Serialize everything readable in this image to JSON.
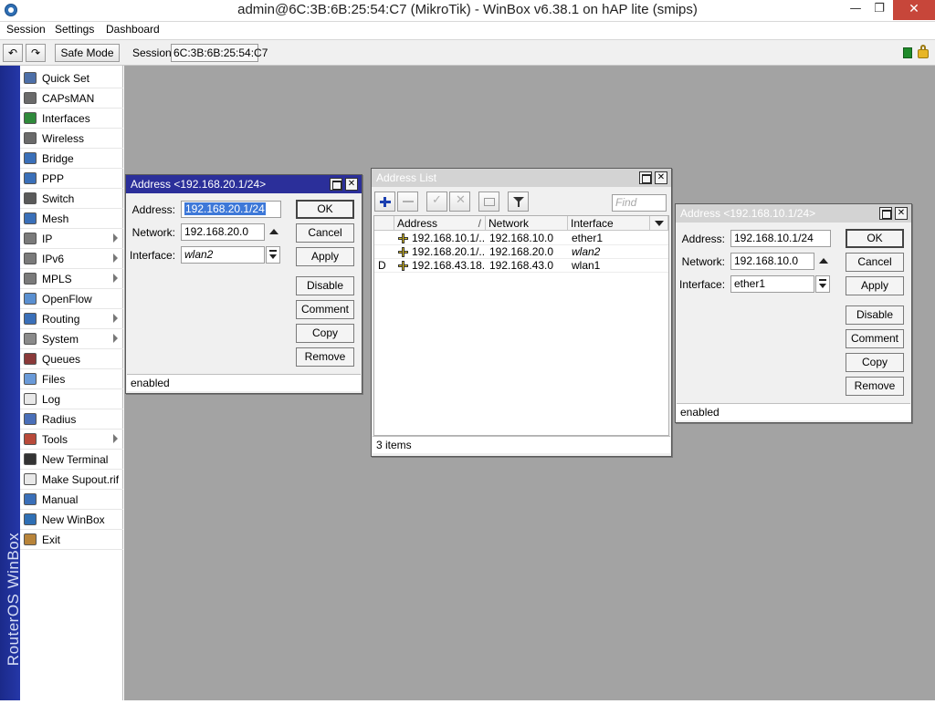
{
  "window": {
    "title": "admin@6C:3B:6B:25:54:C7 (MikroTik) - WinBox v6.38.1 on hAP lite (smips)",
    "min_glyph": "—",
    "max_glyph": "❐",
    "close_glyph": "✕"
  },
  "menu": [
    "Session",
    "Settings",
    "Dashboard"
  ],
  "toolbar": {
    "undo_glyph": "↶",
    "redo_glyph": "↷",
    "safe_mode": "Safe Mode",
    "session_label": "Session:",
    "session_value": "6C:3B:6B:25:54:C7"
  },
  "sidebar": {
    "brand": "RouterOS WinBox",
    "items": [
      {
        "label": "Quick Set",
        "icon": "quick-set-icon",
        "submenu": false
      },
      {
        "label": "CAPsMAN",
        "icon": "capsman-icon",
        "submenu": false
      },
      {
        "label": "Interfaces",
        "icon": "interfaces-icon",
        "submenu": false
      },
      {
        "label": "Wireless",
        "icon": "wireless-icon",
        "submenu": false
      },
      {
        "label": "Bridge",
        "icon": "bridge-icon",
        "submenu": false
      },
      {
        "label": "PPP",
        "icon": "ppp-icon",
        "submenu": false
      },
      {
        "label": "Switch",
        "icon": "switch-icon",
        "submenu": false
      },
      {
        "label": "Mesh",
        "icon": "mesh-icon",
        "submenu": false
      },
      {
        "label": "IP",
        "icon": "ip-icon",
        "submenu": true
      },
      {
        "label": "IPv6",
        "icon": "ipv6-icon",
        "submenu": true
      },
      {
        "label": "MPLS",
        "icon": "mpls-icon",
        "submenu": true
      },
      {
        "label": "OpenFlow",
        "icon": "openflow-icon",
        "submenu": false
      },
      {
        "label": "Routing",
        "icon": "routing-icon",
        "submenu": true
      },
      {
        "label": "System",
        "icon": "system-icon",
        "submenu": true
      },
      {
        "label": "Queues",
        "icon": "queues-icon",
        "submenu": false
      },
      {
        "label": "Files",
        "icon": "files-icon",
        "submenu": false
      },
      {
        "label": "Log",
        "icon": "log-icon",
        "submenu": false
      },
      {
        "label": "Radius",
        "icon": "radius-icon",
        "submenu": false
      },
      {
        "label": "Tools",
        "icon": "tools-icon",
        "submenu": true
      },
      {
        "label": "New Terminal",
        "icon": "terminal-icon",
        "submenu": false
      },
      {
        "label": "Make Supout.rif",
        "icon": "supout-icon",
        "submenu": false
      },
      {
        "label": "Manual",
        "icon": "manual-icon",
        "submenu": false
      },
      {
        "label": "New WinBox",
        "icon": "winbox-icon",
        "submenu": false
      },
      {
        "label": "Exit",
        "icon": "exit-icon",
        "submenu": false
      }
    ]
  },
  "address_dialog_1": {
    "title": "Address <192.168.20.1/24>",
    "address_label": "Address:",
    "address_value": "192.168.20.1/24",
    "network_label": "Network:",
    "network_value": "192.168.20.0",
    "interface_label": "Interface:",
    "interface_value": "wlan2",
    "buttons": [
      "OK",
      "Cancel",
      "Apply",
      "Disable",
      "Comment",
      "Copy",
      "Remove"
    ],
    "status": "enabled"
  },
  "address_list": {
    "title": "Address List",
    "find_placeholder": "Find",
    "columns": [
      "Address",
      "Network",
      "Interface"
    ],
    "sort_glyph": "/",
    "rows": [
      {
        "flag": "",
        "address": "192.168.10.1/...",
        "network": "192.168.10.0",
        "interface": "ether1",
        "italic": false
      },
      {
        "flag": "",
        "address": "192.168.20.1/...",
        "network": "192.168.20.0",
        "interface": "wlan2",
        "italic": true
      },
      {
        "flag": "D",
        "address": "192.168.43.18...",
        "network": "192.168.43.0",
        "interface": "wlan1",
        "italic": false
      }
    ],
    "status": "3 items"
  },
  "address_dialog_2": {
    "title": "Address <192.168.10.1/24>",
    "address_label": "Address:",
    "address_value": "192.168.10.1/24",
    "network_label": "Network:",
    "network_value": "192.168.10.0",
    "interface_label": "Interface:",
    "interface_value": "ether1",
    "buttons": [
      "OK",
      "Cancel",
      "Apply",
      "Disable",
      "Comment",
      "Copy",
      "Remove"
    ],
    "status": "enabled"
  },
  "colors": {
    "active_title": "#2b2f9a",
    "inactive_title": "#d3d3d3",
    "workspace": "#a3a3a3",
    "brand_strip": "#1b2a8a"
  }
}
